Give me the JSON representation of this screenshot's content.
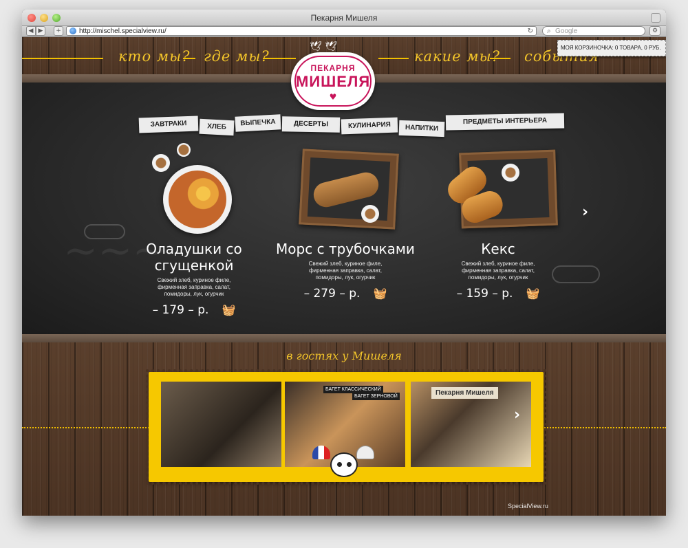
{
  "browser": {
    "window_title": "Пекарня Мишеля",
    "url": "http://mischel.specialview.ru/",
    "search_placeholder": "Google"
  },
  "header": {
    "nav": [
      "кто мы?",
      "где мы?",
      "какие мы?",
      "события"
    ],
    "logo": {
      "line1": "ПЕКАРНЯ",
      "line2": "МИШЕЛЯ"
    },
    "cart_text": "МОЯ КОРЗИНОЧКА: 0 ТОВАРА, 0 РУБ."
  },
  "categories": [
    "ЗАВТРАКИ",
    "ХЛЕБ",
    "ВЫПЕЧКА",
    "ДЕСЕРТЫ",
    "КУЛИНАРИЯ",
    "НАПИТКИ",
    "ПРЕДМЕТЫ ИНТЕРЬЕРА"
  ],
  "products": [
    {
      "name": "Оладушки со сгущенкой",
      "description": [
        "Свежий злеб, куриное филе,",
        "фирменная заправка, салат,",
        "помидоры, лук, огурчик"
      ],
      "price": "– 179 – р."
    },
    {
      "name": "Морс с трубочками",
      "description": [
        "Свежий злеб, куриное филе,",
        "фирменная заправка, салат,",
        "помидоры, лук, огурчик"
      ],
      "price": "– 279 – р."
    },
    {
      "name": "Кекс",
      "description": [
        "Свежий злеб, куриное филе,",
        "фирменная заправка, салат,",
        "помидоры, лук, огурчик"
      ],
      "price": "– 159 – р."
    }
  ],
  "guests": {
    "title": "в гостях у Мишеля",
    "photo_labels": [
      "БАГЕТ КЛАССИЧЕСКИЙ",
      "БАГЕТ ЗЕРНОВОЙ"
    ],
    "shop_sign": "Пекарня Мишеля",
    "credit": "SpecialView.ru"
  },
  "colors": {
    "accent": "#f2c000",
    "brand": "#c8145a"
  }
}
